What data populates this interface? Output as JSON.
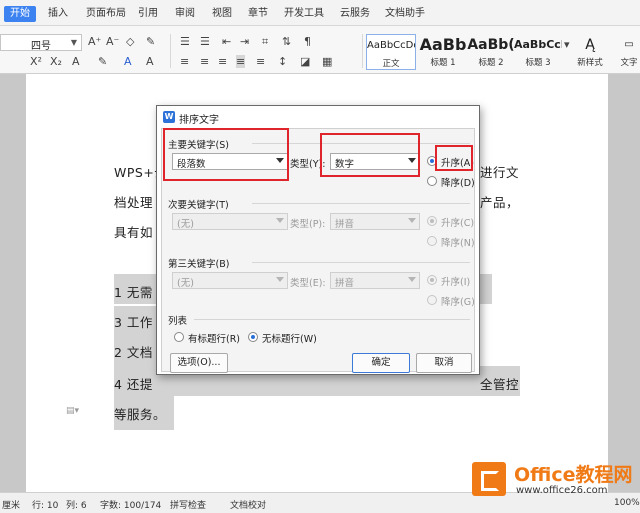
{
  "ribbon": {
    "tabs": [
      "开始",
      "插入",
      "页面布局",
      "引用",
      "审阅",
      "视图",
      "章节",
      "开发工具",
      "云服务",
      "文档助手"
    ]
  },
  "toolbar": {
    "font_size": "四号",
    "styles": [
      {
        "sample": "AaBbCcDd",
        "name": "正文"
      },
      {
        "sample": "AaBb",
        "name": "标题 1"
      },
      {
        "sample": "AaBb(",
        "name": "标题 2"
      },
      {
        "sample": "AaBbCcI",
        "name": "标题 3"
      }
    ],
    "new_style": "新样式",
    "text_tool": "文字"
  },
  "document": {
    "lines": [
      "WPS+云",
      "档处理",
      "具有如",
      "1  无需",
      "3  工作",
      "2  文档",
      "4  还提",
      "等服务。"
    ],
    "right_fragments": [
      "进行文",
      "产品，"
    ],
    "bottom_fragment": "全管控"
  },
  "dialog": {
    "title": "排序文字",
    "primary_key": {
      "label": "主要关键字(S)",
      "value": "段落数",
      "type_label": "类型(Y):",
      "type_value": "数字",
      "asc": "升序(A)",
      "desc": "降序(D)"
    },
    "secondary_key": {
      "label": "次要关键字(T)",
      "value": "(无)",
      "type_label": "类型(P):",
      "type_value": "拼音",
      "asc": "升序(C)",
      "desc": "降序(N)"
    },
    "third_key": {
      "label": "第三关键字(B)",
      "value": "(无)",
      "type_label": "类型(E):",
      "type_value": "拼音",
      "asc": "升序(I)",
      "desc": "降序(G)"
    },
    "list_label": "列表",
    "has_header": "有标题行(R)",
    "no_header": "无标题行(W)",
    "options_button": "选项(O)...",
    "ok_button": "确定",
    "cancel_button": "取消"
  },
  "status_bar": {
    "unit": "厘米",
    "row": "行: 10",
    "col": "列: 6",
    "word_count": "字数: 100/174",
    "spell_check": "拼写检查",
    "doc_check": "文档校对",
    "zoom": "100%"
  },
  "watermark": {
    "brand": "Office教程网",
    "url": "www.office26.com"
  },
  "colors": {
    "accent": "#3c82f0",
    "highlight_box": "#e0242c",
    "logo": "#f07a16"
  }
}
